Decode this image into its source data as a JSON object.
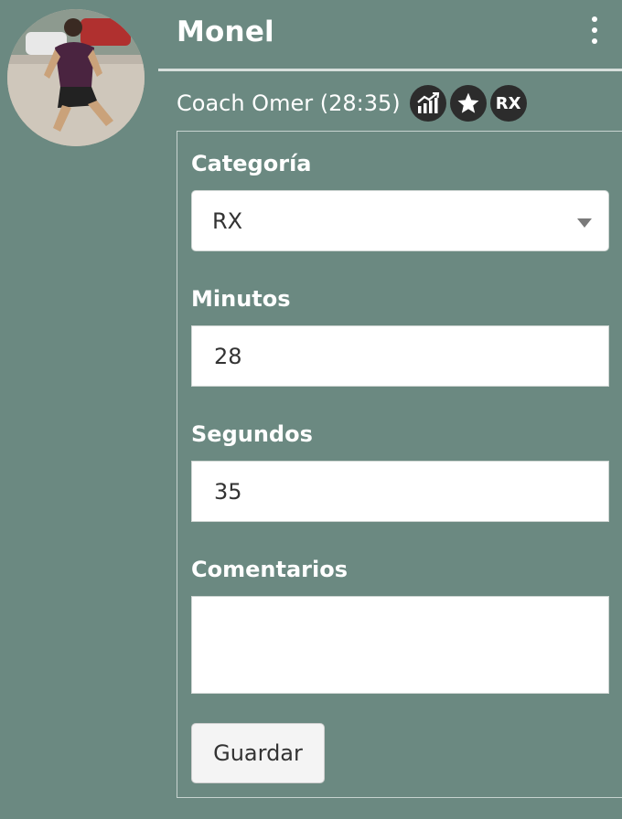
{
  "colors": {
    "background": "#6b8981",
    "badge": "#2c2c2c"
  },
  "athlete": {
    "name": "Monel",
    "avatar": "athlete-photo"
  },
  "menu": {
    "icon": "more-vertical-icon"
  },
  "result": {
    "coach_line": "Coach Omer (28:35)",
    "badges": [
      {
        "icon": "chart-trend-icon"
      },
      {
        "icon": "star-icon"
      },
      {
        "icon": "rx-badge",
        "text": "RX"
      }
    ]
  },
  "form": {
    "category_label": "Categoría",
    "category_value": "RX",
    "minutes_label": "Minutos",
    "minutes_value": "28",
    "seconds_label": "Segundos",
    "seconds_value": "35",
    "comments_label": "Comentarios",
    "comments_value": "",
    "save_label": "Guardar"
  }
}
